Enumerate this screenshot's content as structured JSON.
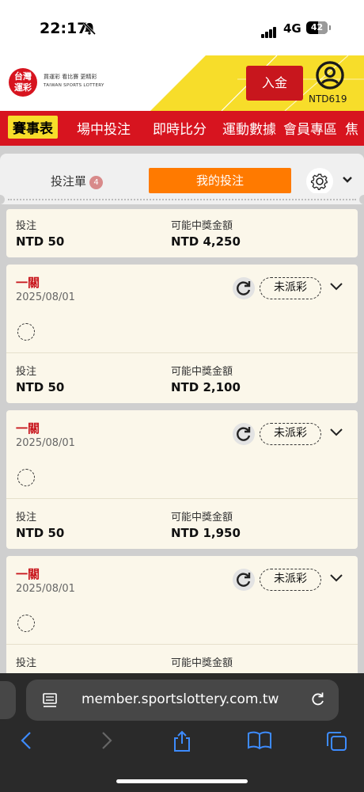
{
  "status_bar": {
    "time": "22:17",
    "network": "4G",
    "battery": "42"
  },
  "header": {
    "logo_text": "台灣\n運彩",
    "logo_tagline": "買運彩 看比賽 更精彩",
    "logo_subtitle": "TAIWAN SPORTS LOTTERY",
    "deposit_label": "入金",
    "balance": "NTD619"
  },
  "nav": {
    "items": [
      "賽事表",
      "場中投注",
      "即時比分",
      "運動數據",
      "會員專區",
      "焦"
    ]
  },
  "tabs": {
    "slip_label": "投注單",
    "slip_count": "4",
    "mybets_label": "我的投注"
  },
  "cards": [
    {
      "bet_label": "投注",
      "bet_value": "NTD 50",
      "payout_label": "可能中獎金額",
      "payout_value": "NTD 4,250"
    },
    {
      "type": "一關",
      "date": "2025/08/01",
      "status": "未派彩",
      "bet_label": "投注",
      "bet_value": "NTD 50",
      "payout_label": "可能中獎金額",
      "payout_value": "NTD 2,100"
    },
    {
      "type": "一關",
      "date": "2025/08/01",
      "status": "未派彩",
      "bet_label": "投注",
      "bet_value": "NTD 50",
      "payout_label": "可能中獎金額",
      "payout_value": "NTD 1,950"
    },
    {
      "type": "一關",
      "date": "2025/08/01",
      "status": "未派彩",
      "bet_label": "投注",
      "payout_label": "可能中獎金額"
    }
  ],
  "browser": {
    "url": "member.sportslottery.com.tw"
  },
  "colors": {
    "brand_red": "#d7141f",
    "brand_yellow": "#f7dd2a",
    "accent_orange": "#ff7a00",
    "card_bg": "#fbf7ea"
  }
}
